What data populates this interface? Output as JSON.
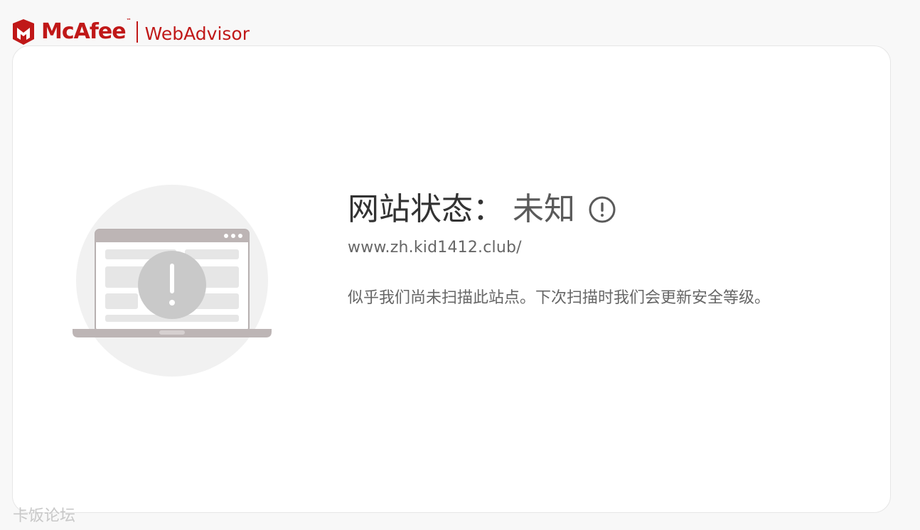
{
  "header": {
    "brand": "McAfee",
    "trademark": "™",
    "product": "WebAdvisor",
    "brand_color": "#c01818"
  },
  "status": {
    "label": "网站状态：",
    "value": "未知",
    "icon": "exclamation-circle-icon",
    "url": "www.zh.kid1412.club/",
    "message": "似乎我们尚未扫描此站点。下次扫描时我们会更新安全等级。"
  },
  "illustration": {
    "icon": "laptop-warning-icon"
  },
  "watermark": {
    "text": "卡饭论坛"
  }
}
